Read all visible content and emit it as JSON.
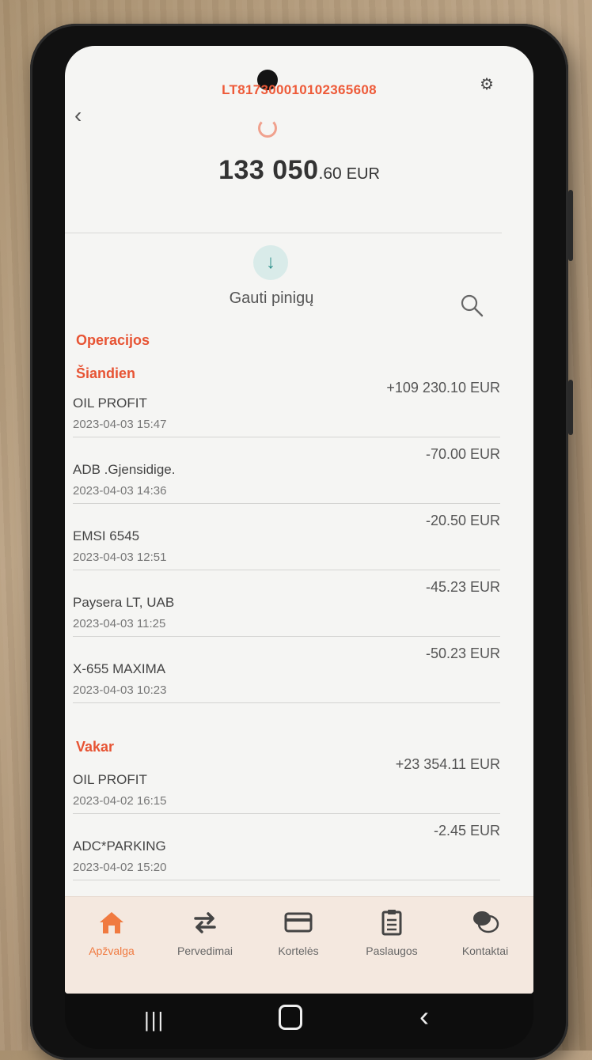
{
  "account": {
    "iban": "LT817300010102365608",
    "balance_main": "133 050",
    "balance_decimals": ".60",
    "balance_currency": "EUR"
  },
  "actions": {
    "receive_label": "Gauti pinigų"
  },
  "operations_title": "Operacijos",
  "groups": [
    {
      "title": "Šiandien",
      "transactions": [
        {
          "name": "OIL PROFIT",
          "date": "2023-04-03 15:47",
          "amount": "+109 230.10 EUR"
        },
        {
          "name": "ADB .Gjensidige.",
          "date": "2023-04-03 14:36",
          "amount": "-70.00 EUR"
        },
        {
          "name": "EMSI 6545",
          "date": "2023-04-03 12:51",
          "amount": "-20.50 EUR"
        },
        {
          "name": "Paysera LT, UAB",
          "date": "2023-04-03 11:25",
          "amount": "-45.23 EUR"
        },
        {
          "name": "X-655 MAXIMA",
          "date": "2023-04-03 10:23",
          "amount": "-50.23 EUR"
        }
      ]
    },
    {
      "title": "Vakar",
      "transactions": [
        {
          "name": "OIL PROFIT",
          "date": "2023-04-02 16:15",
          "amount": "+23 354.11 EUR"
        },
        {
          "name": "ADC*PARKING",
          "date": "2023-04-02 15:20",
          "amount": "-2.45 EUR"
        }
      ]
    }
  ],
  "nav": [
    {
      "label": "Apžvalga",
      "icon": "home-icon",
      "active": true
    },
    {
      "label": "Pervedimai",
      "icon": "transfer-arrows-icon",
      "active": false
    },
    {
      "label": "Kortelės",
      "icon": "card-icon",
      "active": false
    },
    {
      "label": "Paslaugos",
      "icon": "clipboard-icon",
      "active": false
    },
    {
      "label": "Kontaktai",
      "icon": "chat-bubbles-icon",
      "active": false
    }
  ],
  "colors": {
    "accent": "#ee5a38",
    "nav_active": "#f07a40",
    "receive_bg": "#d9ebe9"
  }
}
